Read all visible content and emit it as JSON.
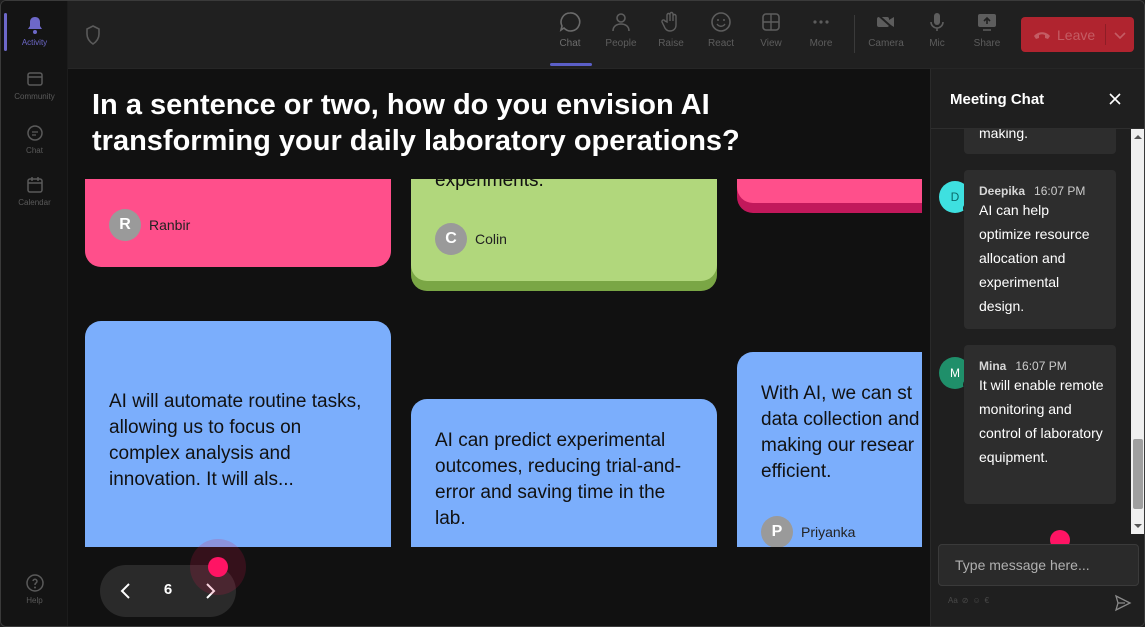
{
  "rail": {
    "items": [
      {
        "label": "Activity",
        "icon": "bell-icon"
      },
      {
        "label": "Community",
        "icon": "community-icon"
      },
      {
        "label": "Chat",
        "icon": "chat-icon"
      },
      {
        "label": "Calendar",
        "icon": "calendar-icon"
      },
      {
        "label": "Help",
        "icon": "help-icon"
      }
    ]
  },
  "toolbar": {
    "chat": "Chat",
    "people": "People",
    "raise": "Raise",
    "react": "React",
    "view": "View",
    "more": "More",
    "camera": "Camera",
    "mic": "Mic",
    "share": "Share",
    "leave": "Leave"
  },
  "question": "In a sentence or two, how do you envision AI transforming your daily laboratory operations?",
  "cards": {
    "ranbir": {
      "initial": "R",
      "name": "Ranbir"
    },
    "colin": {
      "text": "experiments.",
      "initial": "C",
      "name": "Colin"
    },
    "c1": {
      "text": "AI will automate routine tasks, allowing us to focus on complex analysis and innovation. It will als..."
    },
    "c2": {
      "text": "AI can predict experimental outcomes, reducing trial-and-error and saving time in the lab."
    },
    "c3": {
      "text": "With AI, we can st data collection and making our resear efficient.",
      "initial": "P",
      "name": "Priyanka"
    }
  },
  "pager": {
    "page": "6"
  },
  "chat": {
    "title": "Meeting Chat",
    "partial": "making.",
    "messages": [
      {
        "initial": "D",
        "name": "Deepika",
        "time": "16:07 PM",
        "text": "AI can help optimize resource allocation and experimental design."
      },
      {
        "initial": "M",
        "name": "Mina",
        "time": "16:07 PM",
        "text": "It will enable remote monitoring and control of laboratory equipment."
      }
    ],
    "placeholder": "Type message here...",
    "colors": {
      "deepika": "#3ee0e0",
      "mina": "#1f8f6a"
    }
  }
}
